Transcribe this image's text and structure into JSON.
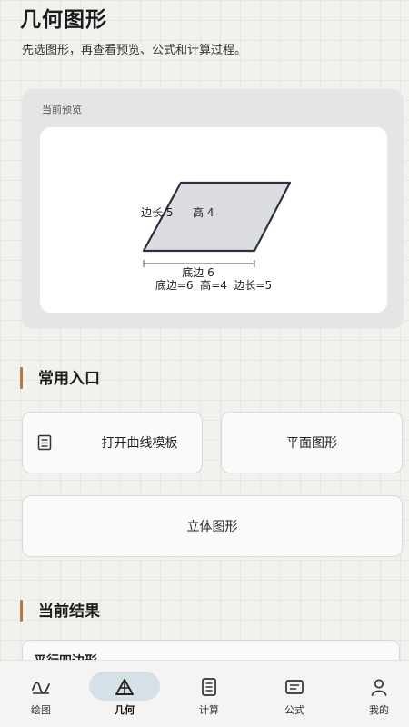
{
  "header": {
    "title": "几何图形",
    "subtitle": "先选图形，再查看预览、公式和计算过程。"
  },
  "preview": {
    "label": "当前预览",
    "side_label": "边长 5",
    "height_label": "高 4",
    "base_label": "底边 6",
    "summary": "底边=6  高=4  边长=5"
  },
  "shortcuts": {
    "title": "常用入口",
    "items": [
      {
        "label": "打开曲线模板",
        "icon": "document-icon"
      },
      {
        "label": "平面图形"
      },
      {
        "label": "立体图形"
      }
    ]
  },
  "results": {
    "title": "当前结果",
    "first_item": "平行四边形"
  },
  "nav": {
    "items": [
      {
        "label": "绘图",
        "icon": "curve-icon"
      },
      {
        "label": "几何",
        "icon": "triangle-icon",
        "active": true
      },
      {
        "label": "计算",
        "icon": "document-icon"
      },
      {
        "label": "公式",
        "icon": "formula-icon"
      },
      {
        "label": "我的",
        "icon": "person-icon"
      }
    ]
  },
  "colors": {
    "accent": "#b7773f",
    "nav_active_pill": "#d6e1e7",
    "shape_fill": "#dcdde0",
    "shape_stroke": "#2c3140"
  }
}
